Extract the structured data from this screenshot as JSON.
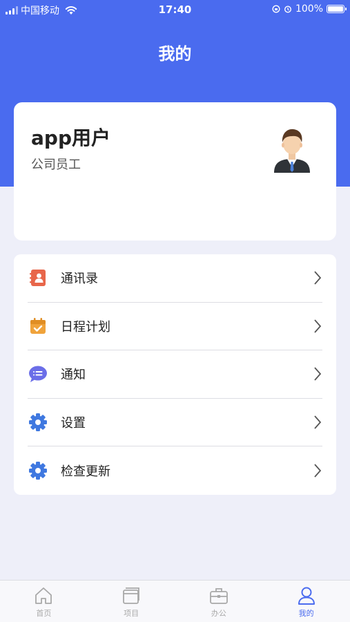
{
  "status_bar": {
    "carrier": "中国移动",
    "time": "17:40",
    "battery": "100%"
  },
  "header": {
    "title": "我的"
  },
  "profile": {
    "name": "app用户",
    "role": "公司员工"
  },
  "menu": {
    "items": [
      {
        "label": "通讯录",
        "icon": "contacts-icon",
        "color": "#e8664a"
      },
      {
        "label": "日程计划",
        "icon": "calendar-icon",
        "color": "#f0a33b"
      },
      {
        "label": "通知",
        "icon": "chat-bubble-icon",
        "color": "#6b6ee8"
      },
      {
        "label": "设置",
        "icon": "gear-icon",
        "color": "#3f78e0"
      },
      {
        "label": "检查更新",
        "icon": "gear-icon",
        "color": "#3f78e0"
      }
    ]
  },
  "tab_bar": {
    "items": [
      {
        "label": "首页",
        "icon": "home-icon",
        "active": false
      },
      {
        "label": "项目",
        "icon": "folder-icon",
        "active": false
      },
      {
        "label": "办公",
        "icon": "briefcase-icon",
        "active": false
      },
      {
        "label": "我的",
        "icon": "person-icon",
        "active": true
      }
    ]
  },
  "colors": {
    "primary": "#4a6bef",
    "background": "#eeeff9"
  }
}
